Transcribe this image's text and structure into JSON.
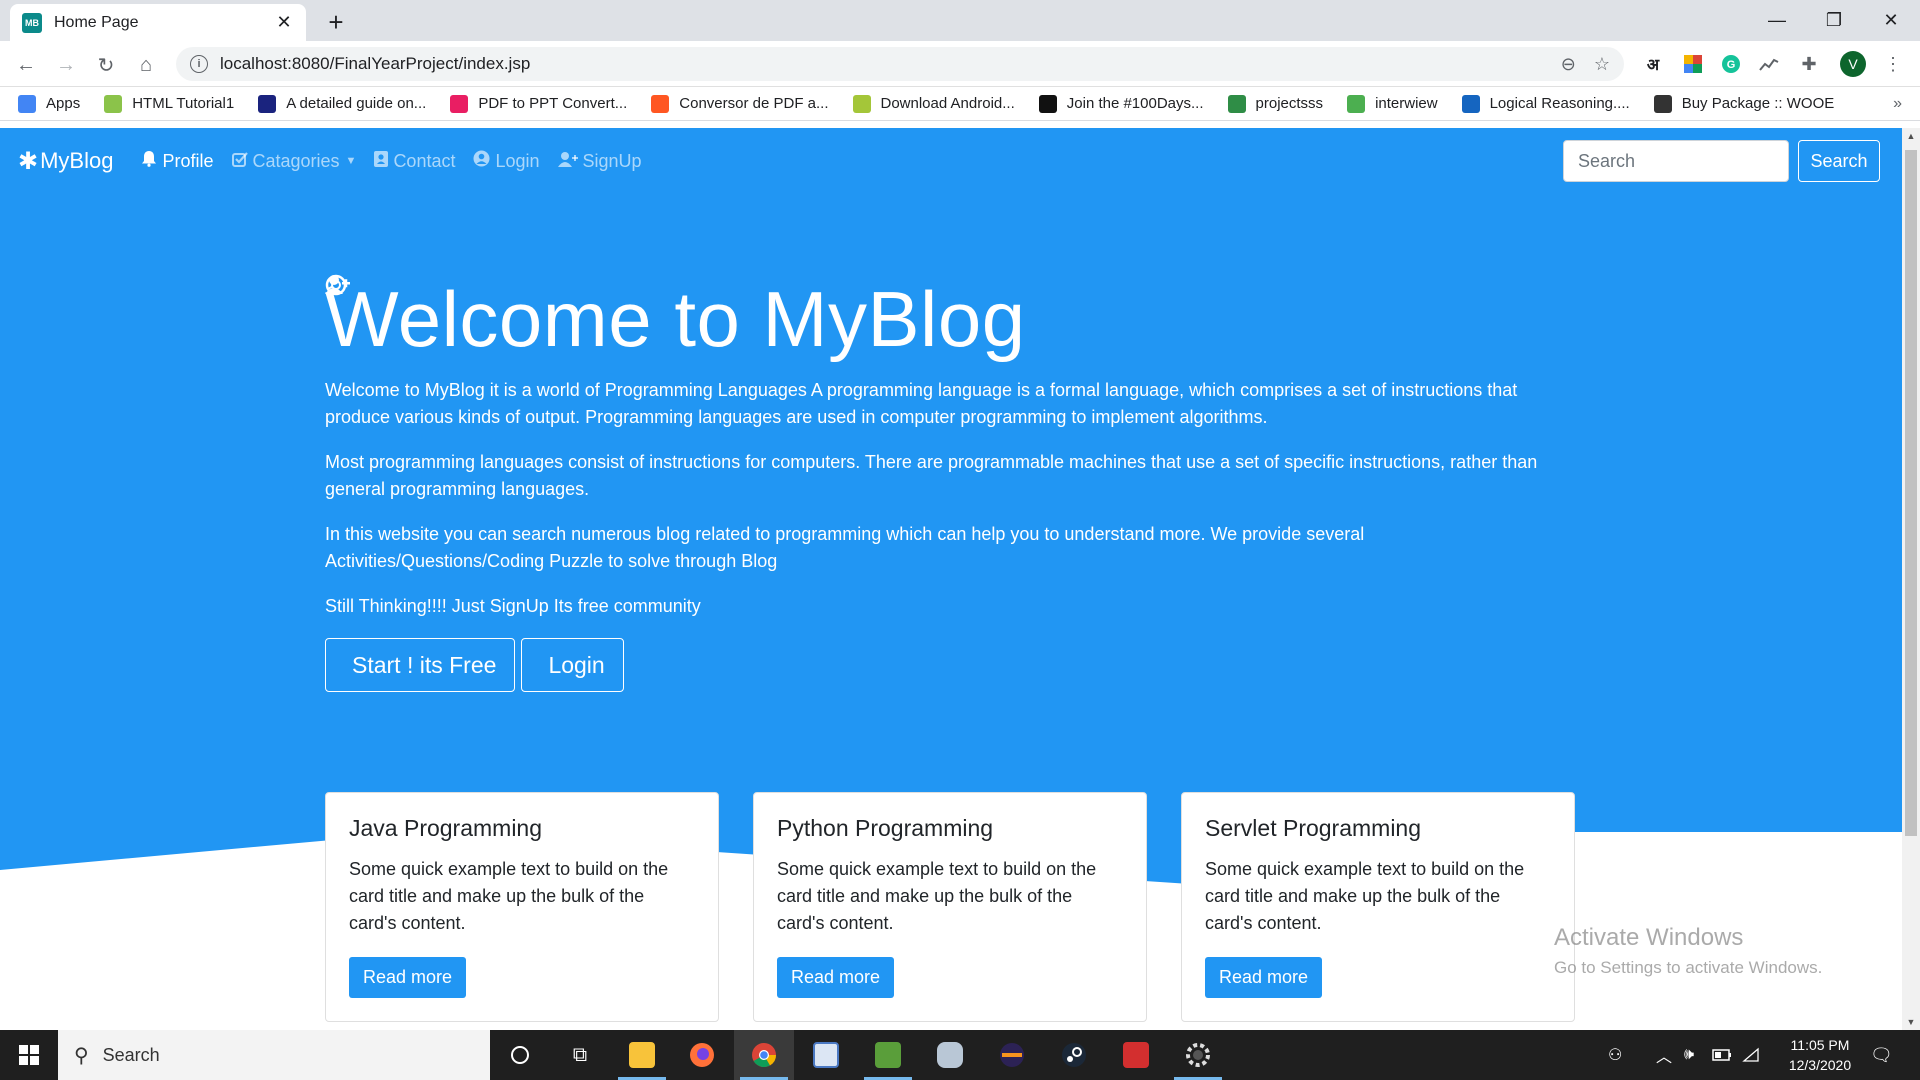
{
  "browser": {
    "tab_title": "Home Page",
    "tab_favicon_text": "MB",
    "url": "localhost:8080/FinalYearProject/index.jsp",
    "profile_initial": "V",
    "hindi_ext": "अ",
    "bookmarks": [
      {
        "label": "Apps",
        "color": "#4285f4"
      },
      {
        "label": "HTML Tutorial1",
        "color": "#8bc34a"
      },
      {
        "label": "A detailed guide on...",
        "color": "#1a237e"
      },
      {
        "label": "PDF to PPT Convert...",
        "color": "#e91e63"
      },
      {
        "label": "Conversor de PDF a...",
        "color": "#ff5722"
      },
      {
        "label": "Download Android...",
        "color": "#a4c639"
      },
      {
        "label": "Join the #100Days...",
        "color": "#111111"
      },
      {
        "label": "projectsss",
        "color": "#2f8d46"
      },
      {
        "label": "interwiew",
        "color": "#4caf50"
      },
      {
        "label": "Logical Reasoning....",
        "color": "#1565c0"
      },
      {
        "label": "Buy Package :: WOOE",
        "color": "#333333"
      }
    ]
  },
  "navbar": {
    "brand": "MyBlog",
    "items": [
      {
        "label": "Profile",
        "icon": "bell-icon"
      },
      {
        "label": "Catagories",
        "icon": "check-square-icon"
      },
      {
        "label": "Contact",
        "icon": "address-book-icon"
      },
      {
        "label": "Login",
        "icon": "user-circle-icon"
      },
      {
        "label": "SignUp",
        "icon": "user-plus-icon"
      }
    ],
    "search_placeholder": "Search",
    "search_button": "Search"
  },
  "hero": {
    "title": "Welcome to MyBlog",
    "paragraphs": [
      "Welcome to MyBlog it is a world of Programming Languages A programming language is a formal language, which comprises a set of instructions that produce various kinds of output. Programming languages are used in computer programming to implement algorithms.",
      "Most programming languages consist of instructions for computers. There are programmable machines that use a set of specific instructions, rather than general programming languages.",
      "In this website you can search numerous blog related to programming which can help you to understand more. We provide several Activities/Questions/Coding Puzzle to solve through Blog",
      "Still Thinking!!!! Just SignUp Its free community"
    ],
    "start_button": "Start ! its Free",
    "login_button": "Login"
  },
  "cards": [
    {
      "title": "Java Programming",
      "text": "Some quick example text to build on the card title and make up the bulk of the card's content.",
      "button": "Read more"
    },
    {
      "title": "Python Programming",
      "text": "Some quick example text to build on the card title and make up the bulk of the card's content.",
      "button": "Read more"
    },
    {
      "title": "Servlet Programming",
      "text": "Some quick example text to build on the card title and make up the bulk of the card's content.",
      "button": "Read more"
    }
  ],
  "watermark": {
    "line1": "Activate Windows",
    "line2": "Go to Settings to activate Windows."
  },
  "taskbar": {
    "search_text": "Search",
    "time": "11:05 PM",
    "date": "12/3/2020"
  },
  "colors": {
    "primary": "#2196f3"
  }
}
